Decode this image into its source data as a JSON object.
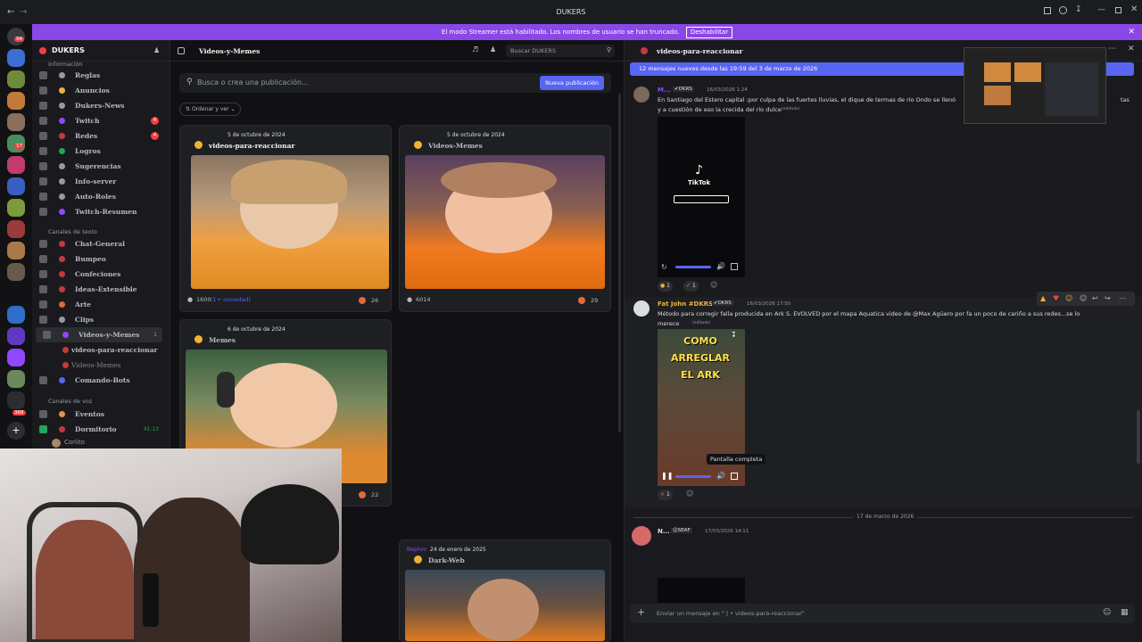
{
  "window": {
    "title": "DUKERS"
  },
  "banner": {
    "text": "El modo Streamer está habilitado. Los nombres de usuario se han truncado.",
    "button": "Deshabilitar"
  },
  "server": {
    "name": "DUKERS"
  },
  "sidebar": {
    "header_cut": "información",
    "items": [
      {
        "label": "Reglas",
        "badge": ""
      },
      {
        "label": "Anuncios",
        "badge": ""
      },
      {
        "label": "Dukers-News",
        "badge": ""
      },
      {
        "label": "Twitch",
        "badge": "4"
      },
      {
        "label": "Redes",
        "badge": "4"
      },
      {
        "label": "Logros",
        "badge": ""
      },
      {
        "label": "Sugerencias",
        "badge": ""
      },
      {
        "label": "Info-server",
        "badge": ""
      },
      {
        "label": "Auto-Roles",
        "badge": ""
      },
      {
        "label": "Twitch-Resumen",
        "badge": ""
      }
    ],
    "cat_text": "Canales de texto",
    "text_items": [
      {
        "label": "Chat-General"
      },
      {
        "label": "Bumpeo"
      },
      {
        "label": "Confeciones"
      },
      {
        "label": "Ideas-Extensible"
      },
      {
        "label": "Arte"
      },
      {
        "label": "Clips"
      },
      {
        "label": "Videos-y-Memes",
        "count": "1"
      },
      {
        "label": "videos-para-reaccionar"
      },
      {
        "label": "Videos-Memes"
      },
      {
        "label": "Comando-Bots"
      }
    ],
    "cat_voice": "Canales de voz",
    "voice_items": [
      {
        "label": "Eventos"
      },
      {
        "label": "Dormitorio",
        "time": "41:13"
      }
    ],
    "voice_user": "Corlito",
    "server_badges": [
      "94",
      "17",
      "368"
    ]
  },
  "forum": {
    "channel": "Videos-y-Memes",
    "search_placeholder": "Busca o crea una publicación...",
    "new_post": "Nueva publicación",
    "sort": "Ordenar y ver",
    "search_server": "Buscar DUKERS",
    "posts": [
      {
        "date": "5 de octubre de 2024",
        "title": "videos-para-reaccionar",
        "count": "1600",
        "new": "(1+ novedad)",
        "reacts": "26"
      },
      {
        "date": "5 de octubre de 2024",
        "title": "Videos-Memes",
        "count": "6014",
        "reacts": "29"
      },
      {
        "date": "6 de octubre de 2024",
        "title": "Memes",
        "reacts": "22"
      },
      {
        "date": "24 de enero de 2025",
        "title": "Dark-Web",
        "author": "Nephro"
      }
    ]
  },
  "chat": {
    "channel": "videos-para-reaccionar",
    "new_msgs": "12 mensajes nuevos desde las 19:59 del 3 de marzo de 2026",
    "msgs": [
      {
        "author": "M...",
        "tag": "DKRS",
        "time": "16/03/2026 1:24",
        "text": "En Santiago del Estero capital :por culpa de las fuertes lluvias, el dique de termas de río Ondo se llenó",
        "text_end": "tas",
        "text2": "y a cuestión de eso la crecida del río dulce",
        "edited": "(editado)",
        "video_label": "TikTok",
        "reacts": [
          "1",
          "1"
        ]
      },
      {
        "author": "Fat John #DKRS",
        "tag": "DKRS",
        "time": "16/03/2026 17:50",
        "text": "Método para corregir falla producida en Ark  S. EVOLVED  por el mapa Aquatica video de @Max Agüero  por fa un poco de cariño a sus redes...se lo",
        "text2": "merece",
        "edited": "(editado)",
        "video_title": "COMO ARREGLAR EL ARK",
        "tooltip": "Pantalla completa",
        "reacts": [
          "1"
        ]
      },
      {
        "author": "N...",
        "tag": "SEAF",
        "time": "17/03/2026 14:11"
      }
    ],
    "date_div": "17 de marzo de 2026",
    "input_placeholder": "Enviar un mensaje en \" | • videos-para-reaccionar\""
  },
  "colors": {
    "accent": "#5865f2",
    "banner": "#8a47e8",
    "bg": "#1a1a1e"
  }
}
